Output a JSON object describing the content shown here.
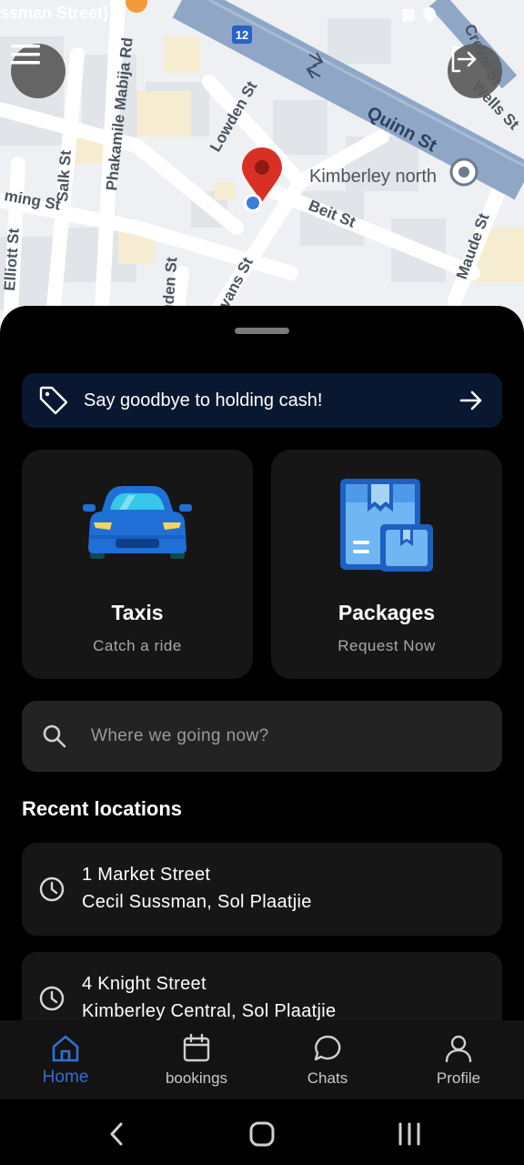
{
  "map": {
    "streets": {
      "sussman": "ssman Street)",
      "phakamile": "Phakamile Mabija Rd",
      "lowden": "Lowden St",
      "salk": "Salk St",
      "ming": "ming St",
      "elliott": "Elliott St",
      "vans": "vans St",
      "uden": "uden St",
      "beit": "Beit St",
      "quinn": "Quinn St",
      "crewe": "Crewe St",
      "wells": "Wells St",
      "maude": "Maude St"
    },
    "place_label": "Kimberley north",
    "route_shield": "12"
  },
  "promo": {
    "text": "Say goodbye to holding cash!"
  },
  "services": [
    {
      "title": "Taxis",
      "subtitle": "Catch a ride"
    },
    {
      "title": "Packages",
      "subtitle": "Request Now"
    }
  ],
  "search": {
    "placeholder": "Where we going now?"
  },
  "recent": {
    "title": "Recent locations",
    "items": [
      {
        "line1": "1 Market Street",
        "line2": "Cecil Sussman, Sol Plaatjie"
      },
      {
        "line1": "4 Knight Street",
        "line2": "Kimberley Central, Sol Plaatjie"
      }
    ]
  },
  "nav": {
    "items": [
      {
        "label": "Home",
        "icon": "home-icon",
        "active": true
      },
      {
        "label": "bookings",
        "icon": "calendar-icon"
      },
      {
        "label": "Chats",
        "icon": "chat-bubble-icon"
      },
      {
        "label": "Profile",
        "icon": "person-icon"
      }
    ]
  },
  "colors": {
    "accent": "#2f6fd6",
    "promo_bg": "#0a1730",
    "card_bg": "#161616",
    "pin": "#d93025"
  }
}
